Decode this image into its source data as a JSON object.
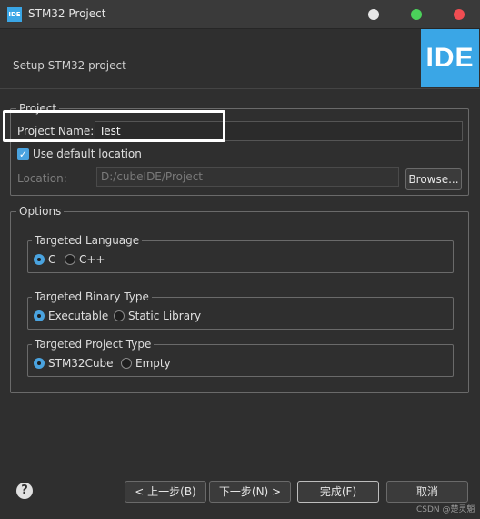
{
  "window": {
    "badge": "IDE",
    "title": "STM32 Project"
  },
  "header": {
    "title": "Setup STM32 project",
    "logo": "IDE"
  },
  "project_group": {
    "label": "Project",
    "name_label": "Project Name:",
    "name_value": "Test",
    "default_location_label": "Use default location",
    "default_location_checked": true,
    "location_label": "Location:",
    "location_value": "D:/cubeIDE/Project",
    "browse_label": "Browse..."
  },
  "options_group": {
    "label": "Options",
    "language": {
      "label": "Targeted Language",
      "options": [
        "C",
        "C++"
      ],
      "selected": "C"
    },
    "binary_type": {
      "label": "Targeted Binary Type",
      "options": [
        "Executable",
        "Static Library"
      ],
      "selected": "Executable"
    },
    "project_type": {
      "label": "Targeted Project Type",
      "options": [
        "STM32Cube",
        "Empty"
      ],
      "selected": "STM32Cube"
    }
  },
  "footer": {
    "back_label": "< 上一步(B)",
    "next_label": "下一步(N) >",
    "finish_label": "完成(F)",
    "cancel_label": "取消",
    "watermark": "CSDN @楚灵魈"
  },
  "icons": {
    "help": "help-icon",
    "checkbox": "checkmark-icon"
  },
  "colors": {
    "accent": "#3aa6e6",
    "background": "#2f2f2f",
    "title_dot_white": "#e6e6e6",
    "title_dot_green": "#4bd15a",
    "title_dot_red": "#f04d52"
  }
}
